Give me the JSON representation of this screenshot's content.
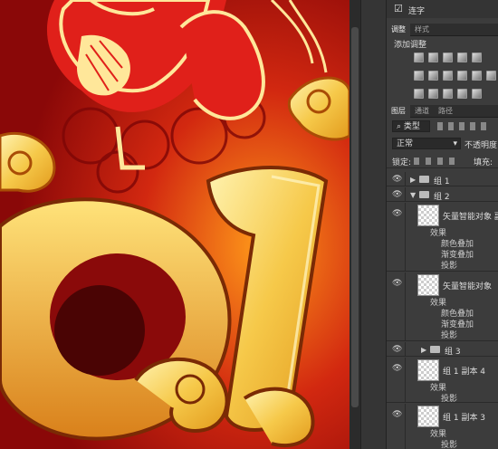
{
  "top": {
    "checkbox_mark": "☑",
    "label": "连字"
  },
  "adjustments": {
    "tabs": [
      "调整",
      "样式"
    ],
    "title": "添加调整"
  },
  "layers_panel": {
    "tabs": [
      "图层",
      "通道",
      "路径"
    ],
    "filter_kind": "类型",
    "blend_mode": "正常",
    "opacity_label": "不透明度",
    "lock_label": "锁定:",
    "fill_label": "填充:"
  },
  "layers": [
    {
      "name": "组 1"
    },
    {
      "name": "组 2"
    },
    {
      "name": "矢量智能对象 副",
      "effects_label": "效果",
      "effects": [
        "颜色叠加",
        "渐变叠加",
        "投影"
      ]
    },
    {
      "name": "矢量智能对象",
      "effects_label": "效果",
      "effects": [
        "颜色叠加",
        "渐变叠加",
        "投影"
      ]
    },
    {
      "name": "组 3"
    },
    {
      "name": "组 1 副本 4",
      "effects_label": "效果",
      "effects": [
        "投影"
      ]
    },
    {
      "name": "组 1 副本 3",
      "effects_label": "效果",
      "effects": [
        "投影"
      ]
    }
  ],
  "colors": {
    "panel_bg": "#3c3c3c",
    "artwork_red": "#b40f10",
    "artwork_gold": "#f6c94a"
  }
}
